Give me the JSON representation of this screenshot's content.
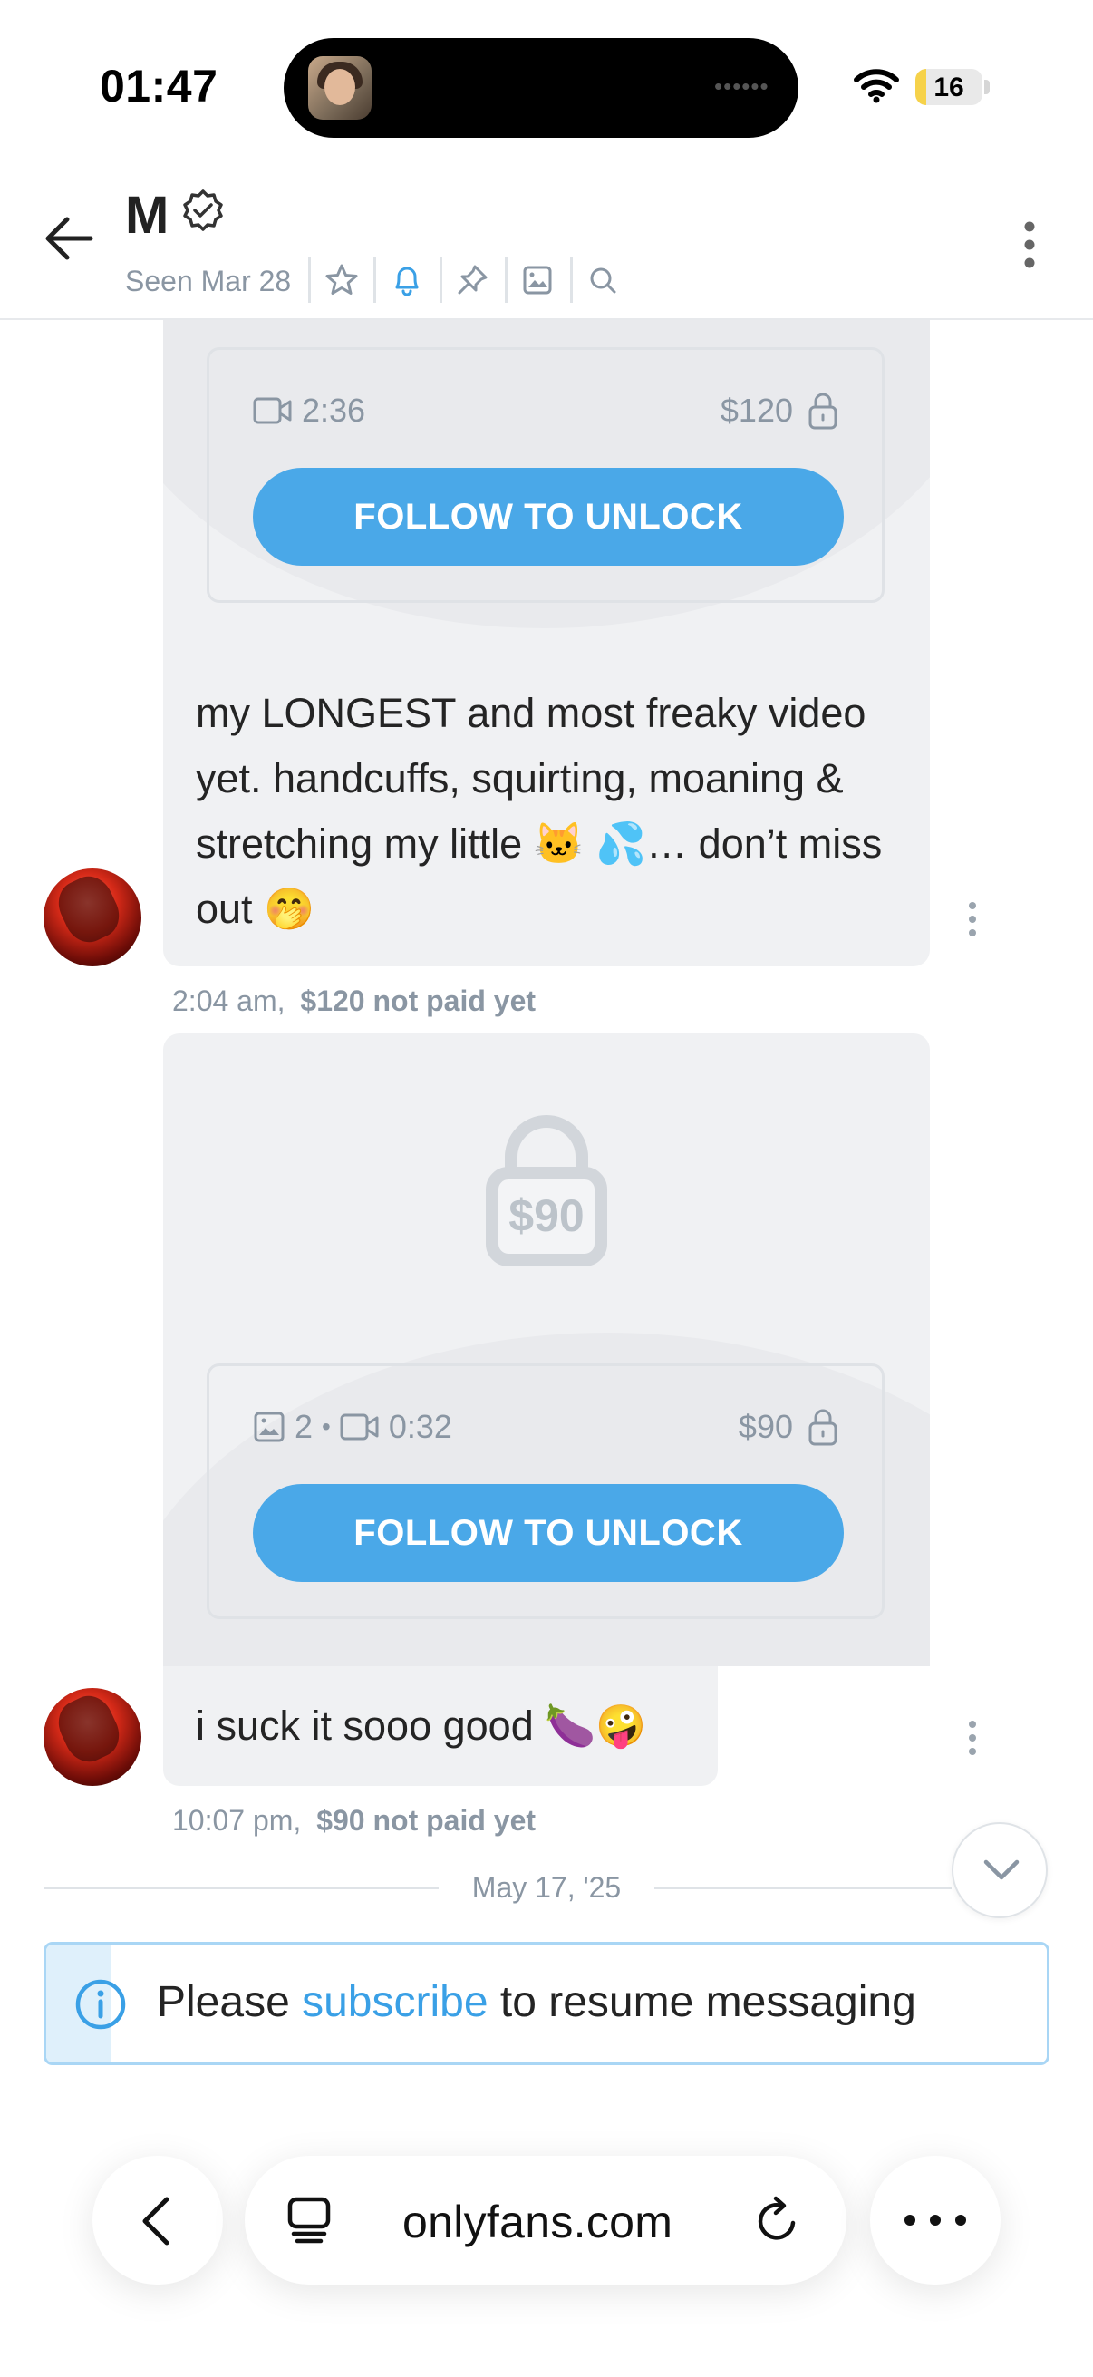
{
  "status_bar": {
    "time": "01:47",
    "battery": "16",
    "battery_level_percent": 16
  },
  "header": {
    "contact_name": "M",
    "seen": "Seen Mar 28",
    "icons": [
      "star-icon",
      "bell-icon",
      "pin-icon",
      "image-icon",
      "search-icon"
    ]
  },
  "messages": [
    {
      "type": "locked_media",
      "video_duration": "2:36",
      "price": "$120",
      "button": "FOLLOW TO UNLOCK"
    },
    {
      "type": "text",
      "text": "my LONGEST and most freaky video yet. handcuffs, squirting, moaning & stretching my little 🐱 💦… don’t miss out 🤭",
      "time": "2:04 am,",
      "status": "$120 not paid yet"
    },
    {
      "type": "locked_media",
      "preview_price": "$90",
      "photo_count": "2",
      "separator": "•",
      "video_duration": "0:32",
      "price": "$90",
      "button": "FOLLOW TO UNLOCK"
    },
    {
      "type": "text",
      "text": "i suck it sooo good 🍆🤪",
      "time": "10:07 pm,",
      "status": "$90 not paid yet"
    }
  ],
  "date_separator": "May 17, '25",
  "subscribe_banner": {
    "before": "Please ",
    "link": "subscribe",
    "after": " to resume messaging"
  },
  "browser": {
    "url": "onlyfans.com"
  },
  "colors": {
    "accent": "#4aa8e8",
    "bubble": "#f0f1f3",
    "muted_text": "#8a96a3",
    "banner_border": "#a9d6f5"
  }
}
